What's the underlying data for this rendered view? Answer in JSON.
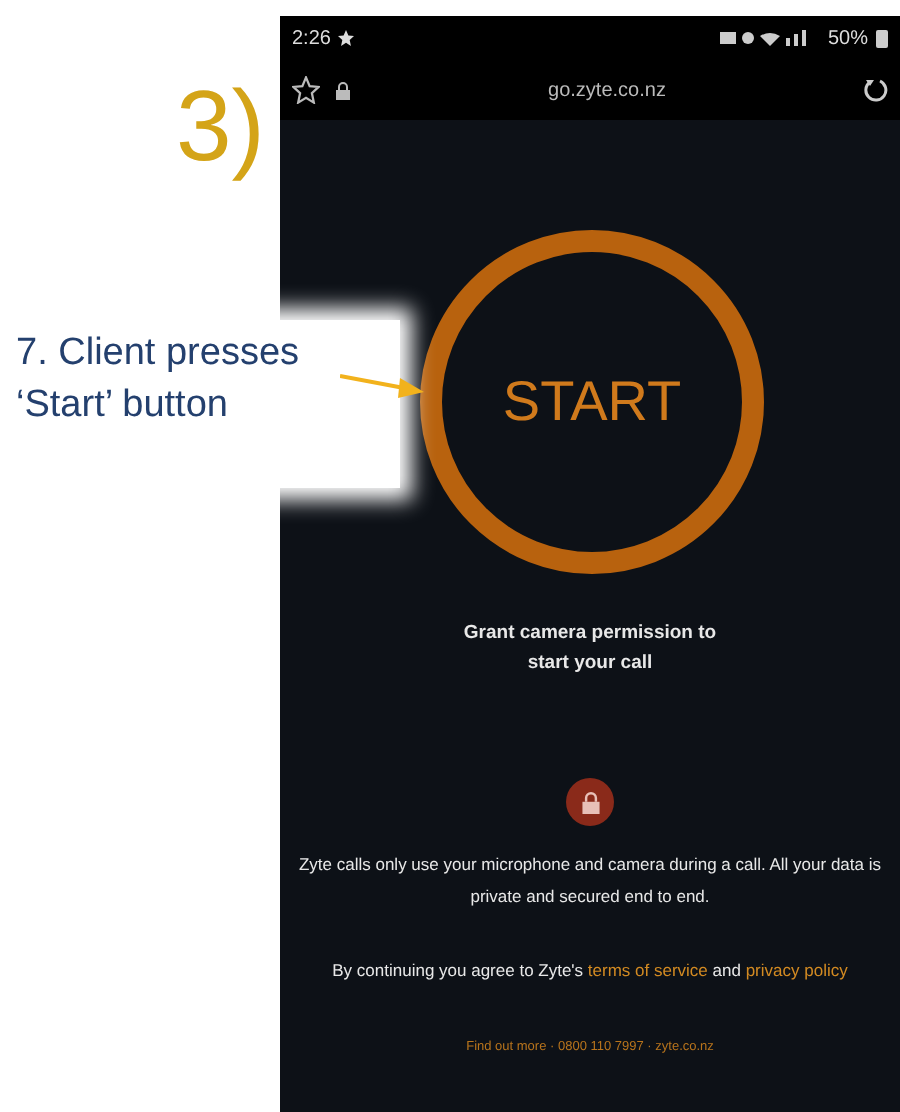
{
  "step_label": "3)",
  "annotation": {
    "text": "7. Client presses ‘Start’ button"
  },
  "phone": {
    "status_bar": {
      "time": "2:26",
      "battery": "50%"
    },
    "browser_bar": {
      "url": "go.zyte.co.nz"
    },
    "start_button": {
      "label": "START"
    },
    "permission_text": "Grant camera permission to start your call",
    "privacy_text": "Zyte calls only use your microphone and camera during a call. All your data is private and secured end to end.",
    "consent": {
      "before": "By continuing you agree to Zyte's ",
      "terms_link": "terms of service",
      "middle": " and ",
      "privacy_link": "privacy policy"
    },
    "footer": "Find out more · 0800 110 7997 · zyte.co.nz"
  }
}
